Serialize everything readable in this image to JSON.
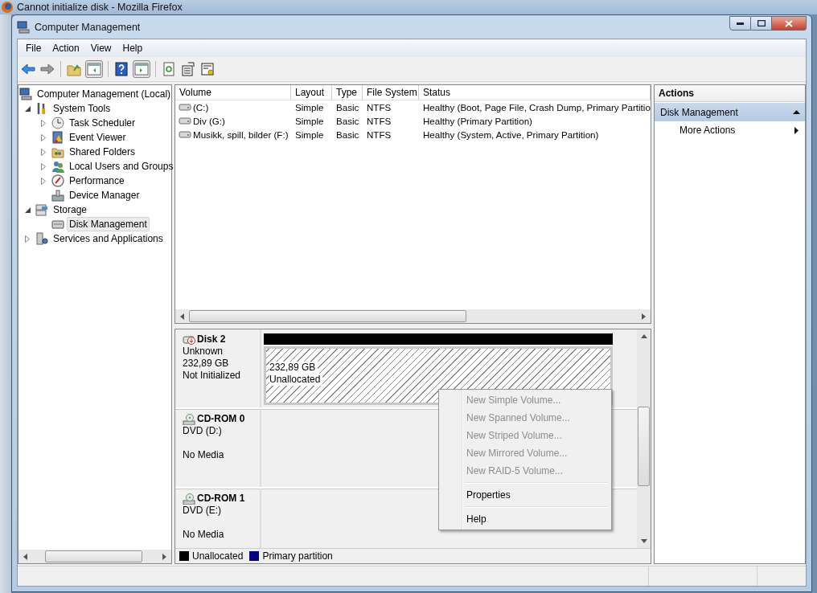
{
  "browser_window": {
    "title": "Cannot initialize disk - Mozilla Firefox"
  },
  "window": {
    "title": "Computer Management"
  },
  "menu_bar": [
    "File",
    "Action",
    "View",
    "Help"
  ],
  "tree": [
    {
      "label": "Computer Management (Local)",
      "selected": false,
      "children": [
        {
          "label": "System Tools",
          "expanded": true,
          "selected": false,
          "children": [
            {
              "label": "Task Scheduler",
              "expanded": false,
              "selected": false
            },
            {
              "label": "Event Viewer",
              "expanded": false,
              "selected": false
            },
            {
              "label": "Shared Folders",
              "expanded": false,
              "selected": false
            },
            {
              "label": "Local Users and Groups",
              "expanded": false,
              "selected": false
            },
            {
              "label": "Performance",
              "expanded": false,
              "selected": false
            },
            {
              "label": "Device Manager",
              "selected": false
            }
          ]
        },
        {
          "label": "Storage",
          "expanded": true,
          "selected": false,
          "children": [
            {
              "label": "Disk Management",
              "selected": true
            }
          ]
        },
        {
          "label": "Services and Applications",
          "expanded": false,
          "selected": false
        }
      ]
    }
  ],
  "volumes": {
    "columns": [
      "Volume",
      "Layout",
      "Type",
      "File System",
      "Status"
    ],
    "rows": [
      [
        "(C:)",
        "Simple",
        "Basic",
        "NTFS",
        "Healthy (Boot, Page File, Crash Dump, Primary Partitio"
      ],
      [
        "Div (G:)",
        "Simple",
        "Basic",
        "NTFS",
        "Healthy (Primary Partition)"
      ],
      [
        "Musikk, spill, bilder (F:)",
        "Simple",
        "Basic",
        "NTFS",
        "Healthy (System, Active, Primary Partition)"
      ]
    ]
  },
  "disks": [
    {
      "kind": "disk",
      "name": "Disk 2",
      "type": "Unknown",
      "size": "232,89 GB",
      "status": "Not Initialized",
      "partitions": [
        {
          "kind": "unallocated",
          "size": "232,89 GB",
          "label": "Unallocated"
        }
      ]
    },
    {
      "kind": "cdrom",
      "name": "CD-ROM 0",
      "type": "DVD (D:)",
      "status": "No Media"
    },
    {
      "kind": "cdrom",
      "name": "CD-ROM 1",
      "type": "DVD (E:)",
      "status": "No Media"
    }
  ],
  "legend": [
    {
      "label": "Unallocated",
      "color": "#000000"
    },
    {
      "label": "Primary partition",
      "color": "#000080"
    }
  ],
  "context_menu": {
    "groups": [
      [
        {
          "label": "New Simple Volume...",
          "disabled": true
        },
        {
          "label": "New Spanned Volume...",
          "disabled": true
        },
        {
          "label": "New Striped Volume...",
          "disabled": true
        },
        {
          "label": "New Mirrored Volume...",
          "disabled": true
        },
        {
          "label": "New RAID-5 Volume...",
          "disabled": true
        }
      ],
      [
        {
          "label": "Properties",
          "disabled": false
        }
      ],
      [
        {
          "label": "Help",
          "disabled": false
        }
      ]
    ]
  },
  "actions": {
    "title": "Actions",
    "sections": [
      {
        "label": "Disk Management",
        "expanded": true,
        "items": [
          {
            "label": "More Actions",
            "kind": "submenu"
          }
        ]
      }
    ]
  }
}
